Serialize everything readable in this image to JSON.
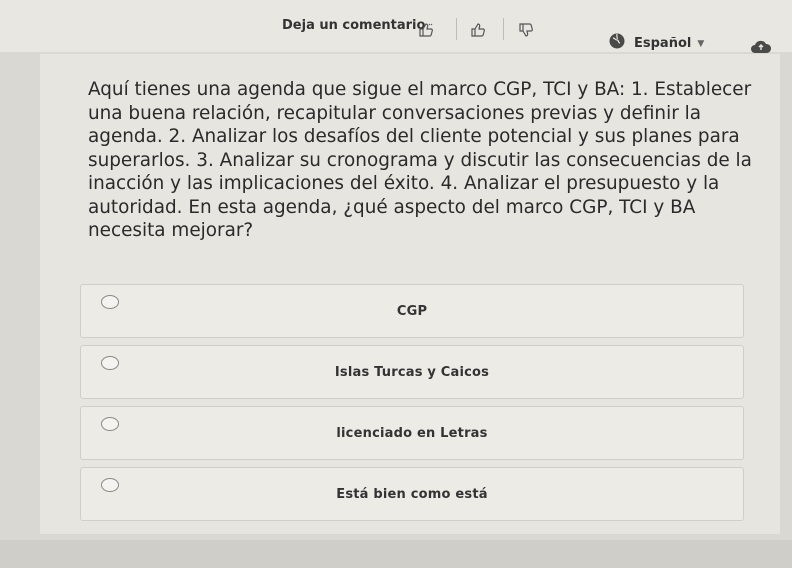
{
  "toolbar": {
    "feedback_label": "Deja un comentario",
    "icons": [
      "thumbs-up-icon",
      "thumbs-up-outline-icon",
      "thumbs-down-icon"
    ],
    "language": "Español",
    "cloud_icon": "cloud-upload-icon"
  },
  "question": {
    "text": "Aquí tienes una agenda que sigue el marco CGP, TCI y BA: 1. Establecer una buena relación, recapitular conversaciones previas y definir la agenda. 2. Analizar los desafíos del cliente potencial y sus planes para superarlos. 3. Analizar su cronograma y discutir las consecuencias de la inacción y las implicaciones del éxito. 4. Analizar el presupuesto y la autoridad. En esta agenda, ¿qué aspecto del marco CGP, TCI y BA necesita mejorar?"
  },
  "options": [
    {
      "label": "CGP"
    },
    {
      "label": "Islas Turcas y Caicos"
    },
    {
      "label": "licenciado en Letras"
    },
    {
      "label": "Está bien como está"
    }
  ],
  "colors": {
    "background": "#d9d8d3",
    "card": "#e6e5e0",
    "option": "#ecebe6",
    "text": "#2a2a2a"
  }
}
